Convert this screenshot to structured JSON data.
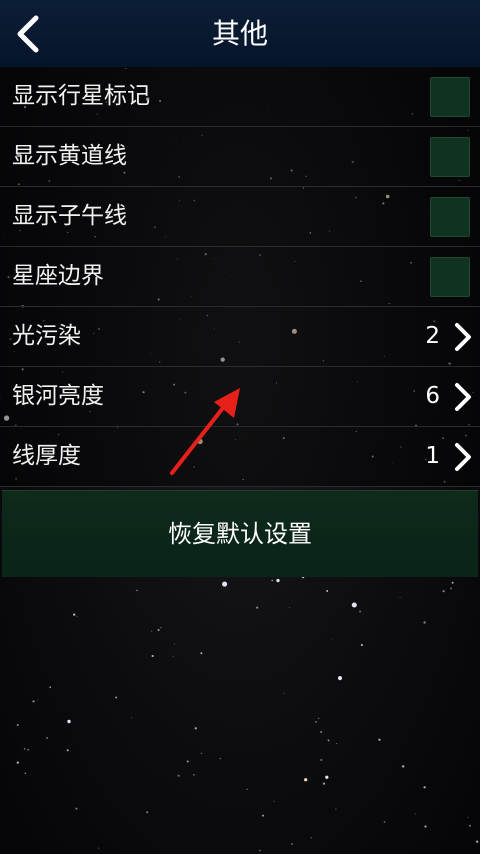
{
  "header": {
    "title": "其他",
    "back_icon": "chevron-left-icon"
  },
  "settings": {
    "rows": [
      {
        "label": "显示行星标记",
        "type": "toggle",
        "checked": false
      },
      {
        "label": "显示黄道线",
        "type": "toggle",
        "checked": false
      },
      {
        "label": "显示子午线",
        "type": "toggle",
        "checked": false
      },
      {
        "label": "星座边界",
        "type": "toggle",
        "checked": false
      },
      {
        "label": "光污染",
        "type": "value",
        "value": "2"
      },
      {
        "label": "银河亮度",
        "type": "value",
        "value": "6"
      },
      {
        "label": "线厚度",
        "type": "value",
        "value": "1"
      }
    ]
  },
  "reset_button": {
    "label": "恢复默认设置"
  },
  "colors": {
    "header_bg": "#06142a",
    "toggle_bg": "#0f3320",
    "reset_bg": "#0a2417",
    "arrow": "#e8201a"
  }
}
